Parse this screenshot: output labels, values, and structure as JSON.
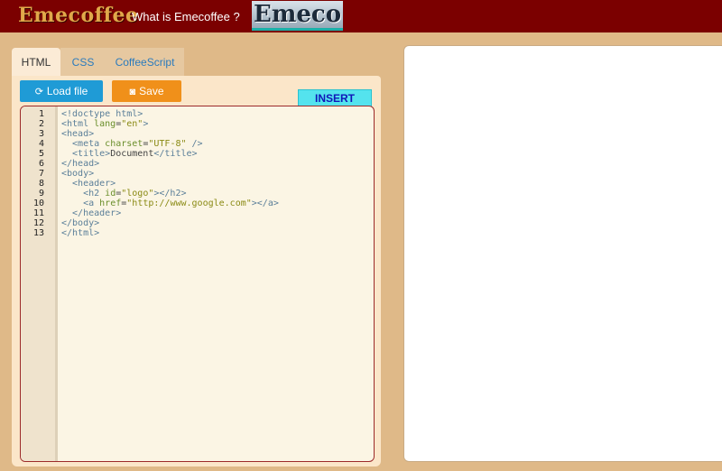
{
  "header": {
    "brand": "Emecoffee",
    "nav_link": "What is Emecoffee ?",
    "logo": "Emeco"
  },
  "tabs": [
    {
      "label": "HTML"
    },
    {
      "label": "CSS"
    },
    {
      "label": "CoffeeScript"
    }
  ],
  "toolbar": {
    "load_label": "Load file",
    "save_label": "Save",
    "mode_label": "INSERT"
  },
  "editor": {
    "lines": [
      [
        {
          "t": "<!doctype html>",
          "c": "tag"
        }
      ],
      [
        {
          "t": "<html ",
          "c": "tag"
        },
        {
          "t": "lang",
          "c": "attr"
        },
        {
          "t": "=",
          "c": "plain"
        },
        {
          "t": "\"en\"",
          "c": "str"
        },
        {
          "t": ">",
          "c": "tag"
        }
      ],
      [
        {
          "t": "<head>",
          "c": "tag"
        }
      ],
      [
        {
          "t": "  <meta ",
          "c": "tag"
        },
        {
          "t": "charset",
          "c": "attr"
        },
        {
          "t": "=",
          "c": "plain"
        },
        {
          "t": "\"UTF-8\"",
          "c": "str"
        },
        {
          "t": " />",
          "c": "tag"
        }
      ],
      [
        {
          "t": "  <title>",
          "c": "tag"
        },
        {
          "t": "Document",
          "c": "plain"
        },
        {
          "t": "</title>",
          "c": "tag"
        }
      ],
      [
        {
          "t": "</head>",
          "c": "tag"
        }
      ],
      [
        {
          "t": "<body>",
          "c": "tag"
        }
      ],
      [
        {
          "t": "  <header>",
          "c": "tag"
        }
      ],
      [
        {
          "t": "    <h2 ",
          "c": "tag"
        },
        {
          "t": "id",
          "c": "attr"
        },
        {
          "t": "=",
          "c": "plain"
        },
        {
          "t": "\"logo\"",
          "c": "str"
        },
        {
          "t": "></h2>",
          "c": "tag"
        }
      ],
      [
        {
          "t": "    <a ",
          "c": "tag"
        },
        {
          "t": "href",
          "c": "attr"
        },
        {
          "t": "=",
          "c": "plain"
        },
        {
          "t": "\"http://www.google.com\"",
          "c": "str"
        },
        {
          "t": "></a>",
          "c": "tag"
        }
      ],
      [
        {
          "t": "  </header>",
          "c": "tag"
        }
      ],
      [
        {
          "t": "</body>",
          "c": "tag"
        }
      ],
      [
        {
          "t": "</html>",
          "c": "tag"
        }
      ]
    ]
  },
  "colors": {
    "header_bg": "#7b0000",
    "page_bg": "#dfb988",
    "load_button": "#1f9bd6",
    "save_button": "#f0901a",
    "insert_badge": "#54e3ee"
  }
}
